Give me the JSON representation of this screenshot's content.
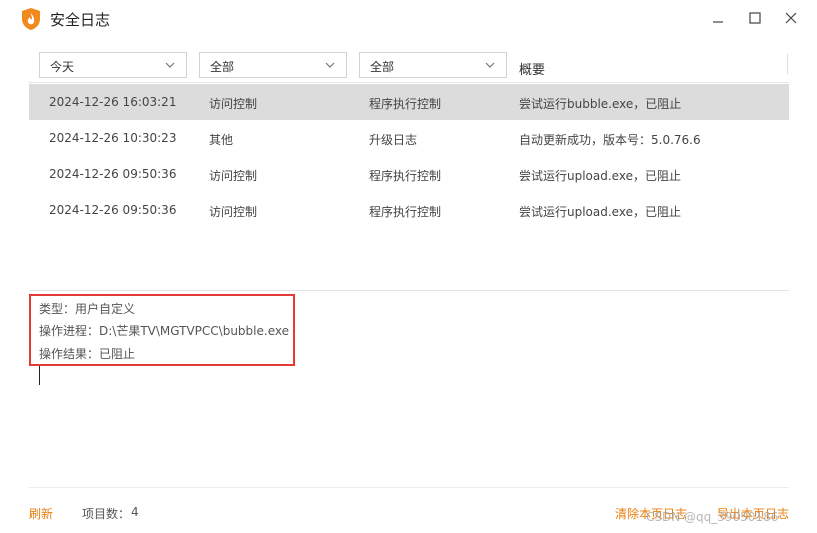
{
  "window": {
    "title": "安全日志"
  },
  "filters": {
    "date": "今天",
    "type": "全部",
    "subtype": "全部",
    "summary_header": "概要"
  },
  "rows": [
    {
      "time": "2024-12-26 16:03:21",
      "type": "访问控制",
      "subtype": "程序执行控制",
      "summary": "尝试运行bubble.exe，已阻止"
    },
    {
      "time": "2024-12-26 10:30:23",
      "type": "其他",
      "subtype": "升级日志",
      "summary": "自动更新成功，版本号：5.0.76.6"
    },
    {
      "time": "2024-12-26 09:50:36",
      "type": "访问控制",
      "subtype": "程序执行控制",
      "summary": "尝试运行upload.exe，已阻止"
    },
    {
      "time": "2024-12-26 09:50:36",
      "type": "访问控制",
      "subtype": "程序执行控制",
      "summary": "尝试运行upload.exe，已阻止"
    }
  ],
  "detail": {
    "type_line": "类型：用户自定义",
    "process_line": "操作进程：D:\\芒果TV\\MGTVPCC\\bubble.exe",
    "result_line": "操作结果：已阻止"
  },
  "footer": {
    "refresh": "刷新",
    "count_label": "项目数：",
    "count": "4",
    "clear": "清除本页日志",
    "export": "导出本页日志"
  },
  "watermark": "CSDN @qq_39050186",
  "colors": {
    "accent": "#e87e0c",
    "selected_row": "#dcdcdc",
    "highlight_box": "#e53935"
  }
}
